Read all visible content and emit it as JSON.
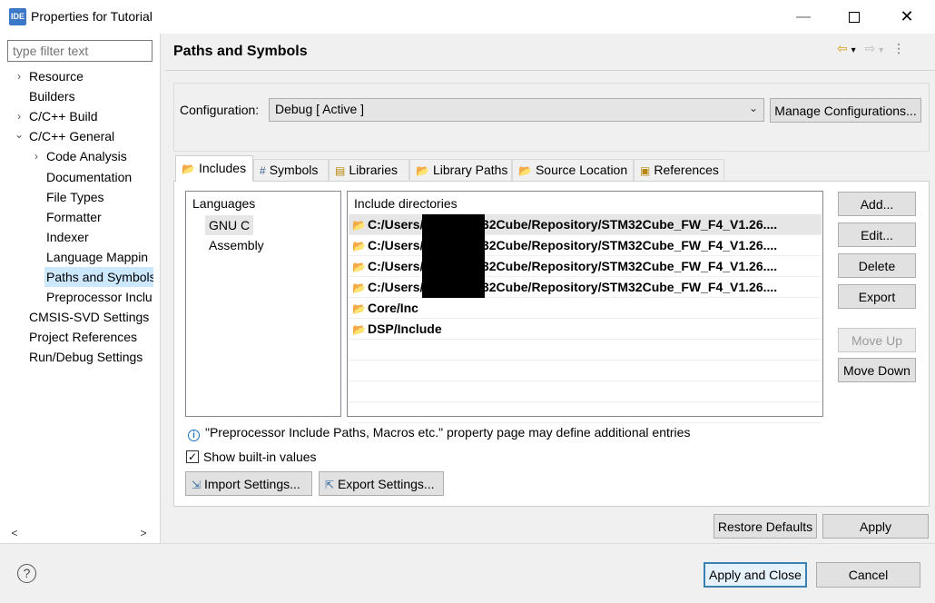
{
  "window": {
    "app_icon_text": "IDE",
    "title": "Properties for Tutorial",
    "min_glyph": "—",
    "close_glyph": "✕"
  },
  "sidebar": {
    "filter_placeholder": "type filter text",
    "items": [
      {
        "label": "Resource",
        "twisty": "›"
      },
      {
        "label": "Builders",
        "twisty": ""
      },
      {
        "label": "C/C++ Build",
        "twisty": "›"
      },
      {
        "label": "C/C++ General",
        "twisty": "⌄"
      },
      {
        "label": "Code Analysis",
        "twisty": "›"
      },
      {
        "label": "Documentation",
        "twisty": ""
      },
      {
        "label": "File Types",
        "twisty": ""
      },
      {
        "label": "Formatter",
        "twisty": ""
      },
      {
        "label": "Indexer",
        "twisty": ""
      },
      {
        "label": "Language Mappin",
        "twisty": ""
      },
      {
        "label": "Paths and Symbols",
        "twisty": "",
        "selected": true
      },
      {
        "label": "Preprocessor Inclu",
        "twisty": ""
      },
      {
        "label": "CMSIS-SVD Settings",
        "twisty": ""
      },
      {
        "label": "Project References",
        "twisty": ""
      },
      {
        "label": "Run/Debug Settings",
        "twisty": ""
      }
    ],
    "scroll_left": "<",
    "scroll_right": ">"
  },
  "page": {
    "title": "Paths and Symbols",
    "nav_back": "⇦",
    "nav_forward": "⇨",
    "nav_dropdown": "▾",
    "nav_menu": "⋮"
  },
  "config": {
    "label": "Configuration:",
    "value": "Debug  [ Active ]",
    "chevron": "⌄",
    "manage_label": "Manage Configurations..."
  },
  "tabs": [
    {
      "label": "Includes",
      "icon": "📂",
      "active": true
    },
    {
      "label": "Symbols",
      "icon": "#"
    },
    {
      "label": "Libraries",
      "icon": "▤"
    },
    {
      "label": "Library Paths",
      "icon": "📂"
    },
    {
      "label": "Source Location",
      "icon": "📂"
    },
    {
      "label": "References",
      "icon": "▣"
    }
  ],
  "languages": {
    "header": "Languages",
    "items": [
      "GNU C",
      "Assembly"
    ]
  },
  "includes": {
    "header": "Include directories",
    "rows": [
      "C:/Users/        /STM32Cube/Repository/STM32Cube_FW_F4_V1.26....",
      "C:/Users/        /STM32Cube/Repository/STM32Cube_FW_F4_V1.26....",
      "C:/Users/        /STM32Cube/Repository/STM32Cube_FW_F4_V1.26....",
      "C:/Users/        /STM32Cube/Repository/STM32Cube_FW_F4_V1.26....",
      "Core/Inc",
      "DSP/Include"
    ]
  },
  "buttons": {
    "add": "Add...",
    "edit": "Edit...",
    "delete": "Delete",
    "export": "Export",
    "move_up": "Move Up",
    "move_down": "Move Down",
    "import_settings": "Import Settings...",
    "export_settings": "Export Settings...",
    "restore_defaults": "Restore Defaults",
    "apply": "Apply",
    "apply_close": "Apply and Close",
    "cancel": "Cancel"
  },
  "info_text": "\"Preprocessor Include Paths, Macros etc.\" property page may define additional entries",
  "show_builtin": {
    "label": "Show built-in values",
    "checked": "✓"
  },
  "help_glyph": "?"
}
